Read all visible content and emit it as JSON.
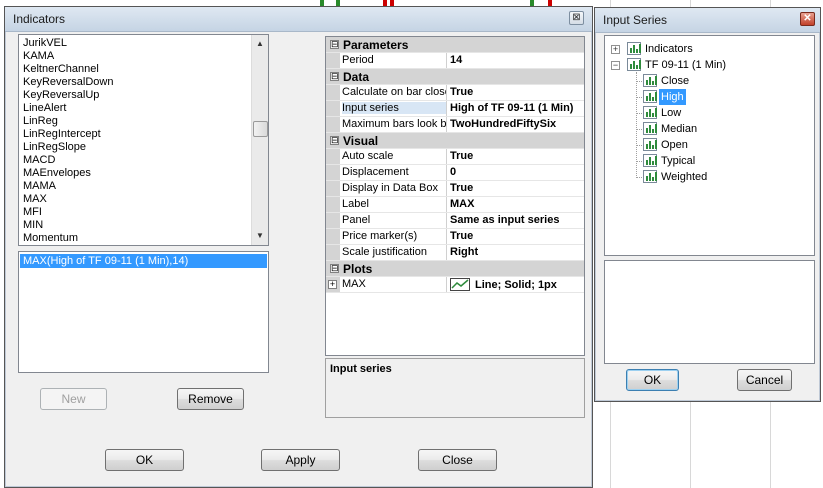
{
  "colors": {
    "accent": "#3399ff",
    "candle_green": "#2a8a2a",
    "candle_red": "#cc0000",
    "plot_line": "#2e8b3c"
  },
  "indicators_dialog": {
    "title": "Indicators",
    "close_glyph": "⊠",
    "indicator_list": [
      "JurikVEL",
      "KAMA",
      "KeltnerChannel",
      "KeyReversalDown",
      "KeyReversalUp",
      "LineAlert",
      "LinReg",
      "LinRegIntercept",
      "LinRegSlope",
      "MACD",
      "MAEnvelopes",
      "MAMA",
      "MAX",
      "MFI",
      "MIN",
      "Momentum"
    ],
    "applied_list": [
      "MAX(High of TF 09-11 (1 Min),14)"
    ],
    "buttons": {
      "new": "New",
      "remove": "Remove",
      "ok": "OK",
      "apply": "Apply",
      "close": "Close"
    },
    "property_grid": {
      "parameters": {
        "label": "Parameters",
        "toggle": "⊟",
        "rows": [
          {
            "name": "Period",
            "value": "14"
          }
        ]
      },
      "data": {
        "label": "Data",
        "toggle": "⊟",
        "rows": [
          {
            "name": "Calculate on bar close",
            "value": "True"
          },
          {
            "name": "Input series",
            "value": "High of TF 09-11 (1 Min)"
          },
          {
            "name": "Maximum bars look back",
            "value": "TwoHundredFiftySix"
          }
        ]
      },
      "visual": {
        "label": "Visual",
        "toggle": "⊟",
        "rows": [
          {
            "name": "Auto scale",
            "value": "True"
          },
          {
            "name": "Displacement",
            "value": "0"
          },
          {
            "name": "Display in Data Box",
            "value": "True"
          },
          {
            "name": "Label",
            "value": "MAX"
          },
          {
            "name": "Panel",
            "value": "Same as input series"
          },
          {
            "name": "Price marker(s)",
            "value": "True"
          },
          {
            "name": "Scale justification",
            "value": "Right"
          }
        ]
      },
      "plots": {
        "label": "Plots",
        "toggle": "⊟",
        "rows": [
          {
            "name": "MAX",
            "value": "Line; Solid; 1px",
            "expander": "+"
          }
        ]
      }
    },
    "help_title": "Input series"
  },
  "input_series_dialog": {
    "title": "Input Series",
    "close_glyph": "✕",
    "tree": {
      "root_indicators": {
        "label": "Indicators",
        "expander": "+"
      },
      "root_series": {
        "label": "TF 09-11 (1 Min)",
        "expander": "−"
      },
      "children": [
        "Close",
        "High",
        "Low",
        "Median",
        "Open",
        "Typical",
        "Weighted"
      ],
      "selected": "High"
    },
    "buttons": {
      "ok": "OK",
      "cancel": "Cancel"
    }
  }
}
